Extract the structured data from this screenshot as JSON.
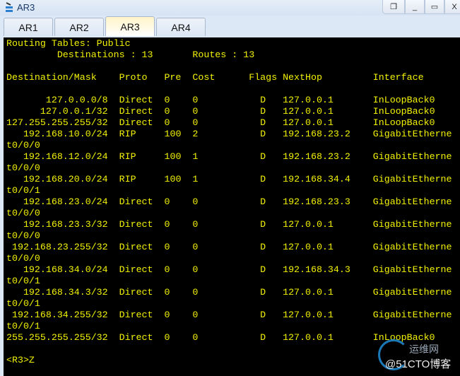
{
  "window": {
    "title": "AR3",
    "buttons": [
      "restore-down",
      "minimize",
      "maximize",
      "close"
    ]
  },
  "tabs": [
    {
      "label": "AR1"
    },
    {
      "label": "AR2"
    },
    {
      "label": "AR3",
      "active": true
    },
    {
      "label": "AR4"
    }
  ],
  "terminal": {
    "text_color": "#f2f200",
    "background": "#000000",
    "title_line": "Routing Tables: Public",
    "destinations_label": "Destinations",
    "destinations": "13",
    "routes_label": "Routes",
    "routes": "13",
    "columns": [
      "Destination/Mask",
      "Proto",
      "Pre",
      "Cost",
      "Flags",
      "NextHop",
      "Interface"
    ],
    "rows": [
      [
        "127.0.0.0/8",
        "Direct",
        "0",
        "0",
        "D",
        "127.0.0.1",
        "InLoopBack0"
      ],
      [
        "127.0.0.1/32",
        "Direct",
        "0",
        "0",
        "D",
        "127.0.0.1",
        "InLoopBack0"
      ],
      [
        "127.255.255.255/32",
        "Direct",
        "0",
        "0",
        "D",
        "127.0.0.1",
        "InLoopBack0"
      ],
      [
        "192.168.10.0/24",
        "RIP",
        "100",
        "2",
        "D",
        "192.168.23.2",
        "GigabitEthernet0/0/0"
      ],
      [
        "192.168.12.0/24",
        "RIP",
        "100",
        "1",
        "D",
        "192.168.23.2",
        "GigabitEthernet0/0/0"
      ],
      [
        "192.168.20.0/24",
        "RIP",
        "100",
        "1",
        "D",
        "192.168.34.4",
        "GigabitEthernet0/0/1"
      ],
      [
        "192.168.23.0/24",
        "Direct",
        "0",
        "0",
        "D",
        "192.168.23.3",
        "GigabitEthernet0/0/0"
      ],
      [
        "192.168.23.3/32",
        "Direct",
        "0",
        "0",
        "D",
        "127.0.0.1",
        "GigabitEthernet0/0/0"
      ],
      [
        "192.168.23.255/32",
        "Direct",
        "0",
        "0",
        "D",
        "127.0.0.1",
        "GigabitEthernet0/0/0"
      ],
      [
        "192.168.34.0/24",
        "Direct",
        "0",
        "0",
        "D",
        "192.168.34.3",
        "GigabitEthernet0/0/1"
      ],
      [
        "192.168.34.3/32",
        "Direct",
        "0",
        "0",
        "D",
        "127.0.0.1",
        "GigabitEthernet0/0/1"
      ],
      [
        "192.168.34.255/32",
        "Direct",
        "0",
        "0",
        "D",
        "127.0.0.1",
        "GigabitEthernet0/0/1"
      ],
      [
        "255.255.255.255/32",
        "Direct",
        "0",
        "0",
        "D",
        "127.0.0.1",
        "InLoopBack0"
      ]
    ],
    "prompt": "<R3>Z"
  },
  "watermark": {
    "top": "运维网",
    "bottom": "@51CTO博客"
  }
}
